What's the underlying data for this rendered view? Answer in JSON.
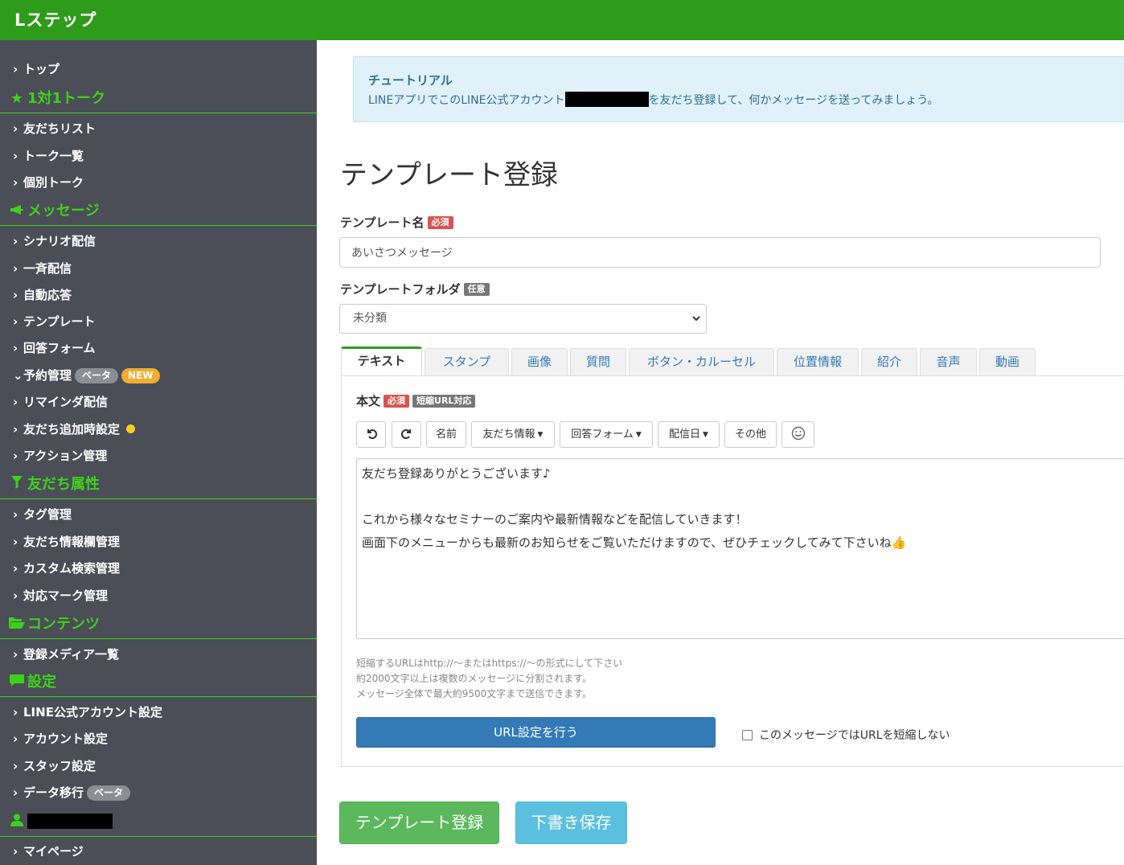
{
  "app": {
    "logo": "Lステップ"
  },
  "sidebar": {
    "top": "トップ",
    "sections": {
      "talk": {
        "title": "1対1トーク",
        "items": [
          "友だちリスト",
          "トーク一覧",
          "個別トーク"
        ]
      },
      "message": {
        "title": "メッセージ",
        "items": [
          "シナリオ配信",
          "一斉配信",
          "自動応答",
          "テンプレート",
          "回答フォーム"
        ]
      },
      "reservation": {
        "label": "予約管理",
        "beta": "ベータ",
        "new": "NEW"
      },
      "message2": {
        "items": [
          "リマインダ配信",
          "友だち追加時設定",
          "アクション管理"
        ]
      },
      "attributes": {
        "title": "友だち属性",
        "items": [
          "タグ管理",
          "友だち情報欄管理",
          "カスタム検索管理",
          "対応マーク管理"
        ]
      },
      "contents": {
        "title": "コンテンツ",
        "items": [
          "登録メディア一覧"
        ]
      },
      "settings": {
        "title": "設定",
        "items": [
          "LINE公式アカウント設定",
          "アカウント設定",
          "スタッフ設定"
        ]
      },
      "migration": {
        "label": "データ移行",
        "beta": "ベータ"
      },
      "user": {
        "items": [
          "マイページ"
        ]
      }
    }
  },
  "tutorial": {
    "title": "チュートリアル",
    "text_before": "LINEアプリでこのLINE公式アカウント",
    "text_after": "を友だち登録して、何かメッセージを送ってみましょう。"
  },
  "page": {
    "title": "テンプレート登録"
  },
  "form": {
    "name_label": "テンプレート名",
    "required": "必須",
    "optional": "任意",
    "name_value": "あいさつメッセージ",
    "folder_label": "テンプレートフォルダ",
    "folder_value": "未分類",
    "tabs": [
      "テキスト",
      "スタンプ",
      "画像",
      "質問",
      "ボタン・カルーセル",
      "位置情報",
      "紹介",
      "音声",
      "動画"
    ],
    "body_label": "本文",
    "short_url_badge": "短縮URL対応",
    "toolbar": {
      "name": "名前",
      "friend_info": "友だち情報",
      "answer_form": "回答フォーム",
      "delivery_date": "配信日",
      "other": "その他"
    },
    "body_lines": [
      "友だち登録ありがとうございます♪",
      "",
      "これから様々なセミナーのご案内や最新情報などを配信していきます！",
      "画面下のメニューからも最新のお知らせをご覧いただけますので、ぜひチェックしてみて下さいね👍"
    ],
    "hints": [
      "短縮するURLはhttp://〜またはhttps://〜の形式にして下さい",
      "約2000文字以上は複数のメッセージに分割されます。",
      "メッセージ全体で最大約9500文字まで送信できます。"
    ],
    "url_button": "URL設定を行う",
    "no_shorten_label": "このメッセージではURLを短縮しない",
    "submit_button": "テンプレート登録",
    "draft_button": "下書き保存"
  },
  "colors": {
    "brand_green": "#2f9b1b",
    "sidebar_bg": "#4b4d57",
    "sidebar_heading": "#3ed11c"
  }
}
